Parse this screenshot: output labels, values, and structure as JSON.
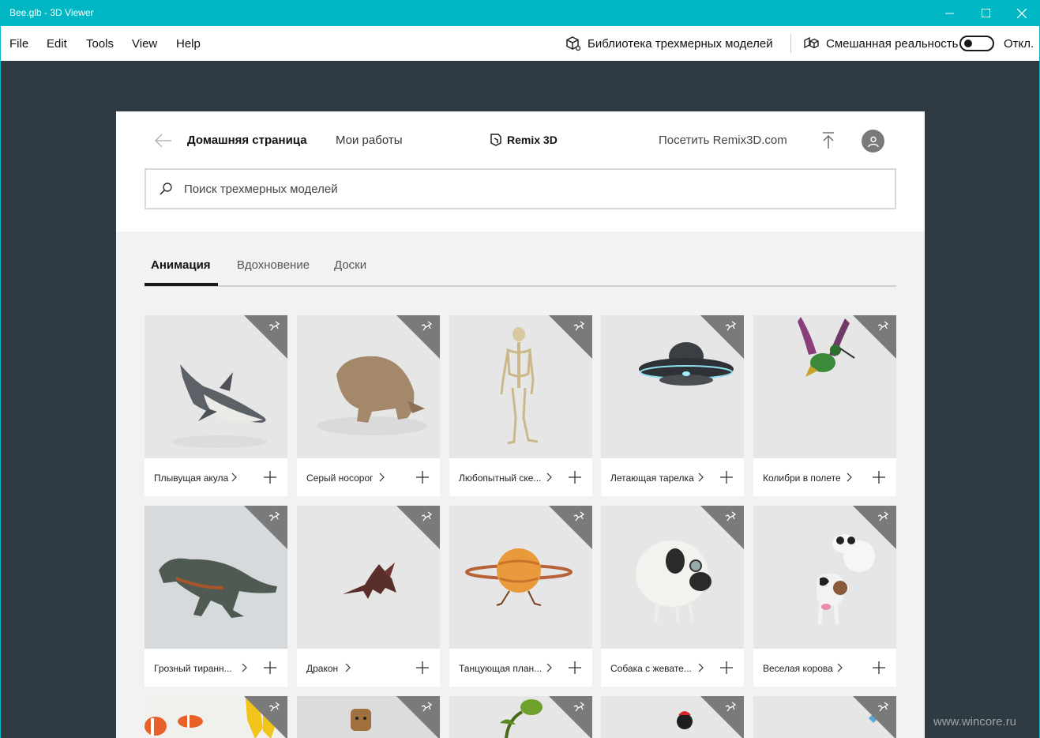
{
  "window": {
    "title": "Bee.glb - 3D Viewer"
  },
  "menu": {
    "items": [
      "File",
      "Edit",
      "Tools",
      "View",
      "Help"
    ],
    "library_label": "Библиотека трехмерных моделей",
    "mixed_reality_label": "Смешанная реальность",
    "toggle_state_label": "Откл."
  },
  "panel": {
    "nav_home": "Домашняя страница",
    "nav_mine": "Мои работы",
    "brand": "Remix 3D",
    "visit_link": "Посетить Remix3D.com",
    "search_placeholder": "Поиск трехмерных моделей",
    "tabs": [
      "Анимация",
      "Вдохновение",
      "Доски"
    ]
  },
  "models": [
    {
      "label": "Плывущая акула"
    },
    {
      "label": "Серый носорог"
    },
    {
      "label": "Любопытный ске..."
    },
    {
      "label": "Летающая тарелка"
    },
    {
      "label": "Колибри в полете"
    },
    {
      "label": "Грозный тиранн..."
    },
    {
      "label": "Дракон"
    },
    {
      "label": "Танцующая план..."
    },
    {
      "label": "Собака с жевате..."
    },
    {
      "label": "Веселая корова"
    }
  ],
  "watermark": "www.wincore.ru",
  "colors": {
    "accent": "#00b7c3",
    "background": "#2f3a42"
  }
}
